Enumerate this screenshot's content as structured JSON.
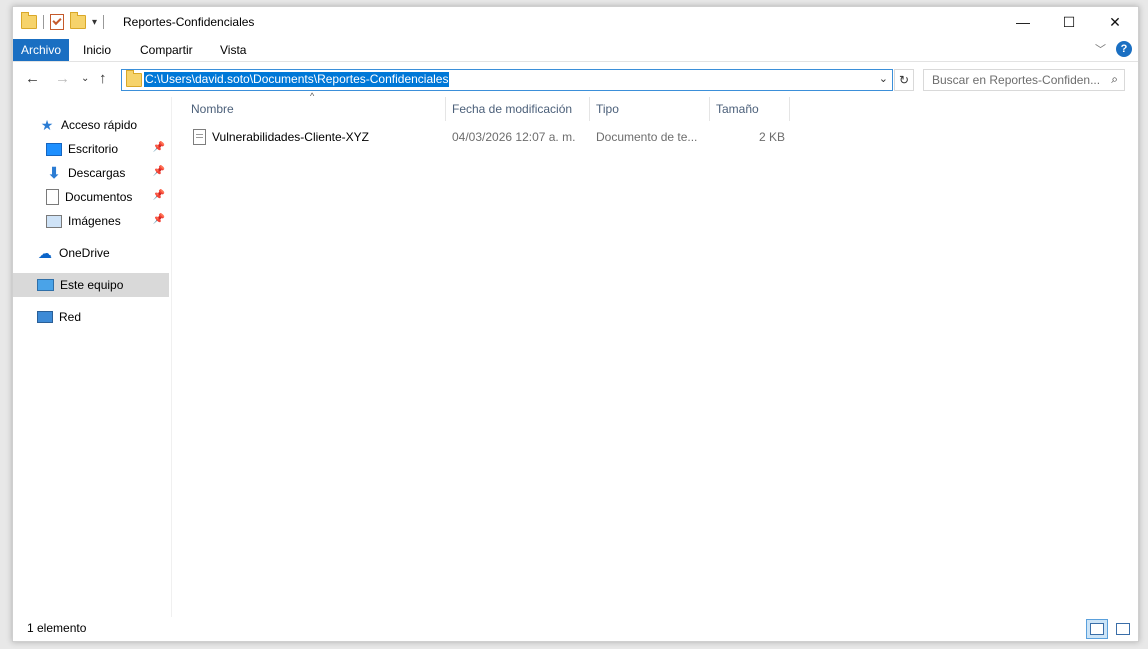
{
  "window": {
    "title": "Reportes-Confidenciales",
    "controls": {
      "minimize": "—",
      "maximize": "☐",
      "close": "✕"
    }
  },
  "ribbon": {
    "tabs": [
      "Archivo",
      "Inicio",
      "Compartir",
      "Vista"
    ],
    "help": "?"
  },
  "address": {
    "path": "C:\\Users\\david.soto\\Documents\\Reportes-Confidenciales"
  },
  "search": {
    "placeholder": "Buscar en Reportes-Confiden..."
  },
  "nav_pane": {
    "quick_access": "Acceso rápido",
    "pinned": [
      "Escritorio",
      "Descargas",
      "Documentos",
      "Imágenes"
    ],
    "onedrive": "OneDrive",
    "this_pc": "Este equipo",
    "network": "Red"
  },
  "columns": [
    "Nombre",
    "Fecha de modificación",
    "Tipo",
    "Tamaño"
  ],
  "files": [
    {
      "name": "Vulnerabilidades-Cliente-XYZ",
      "modified": "04/03/2026 12:07 a. m.",
      "type": "Documento de te...",
      "size": "2 KB"
    }
  ],
  "status_bar": {
    "count": "1 elemento"
  },
  "colors": {
    "accent": "#1a6fc2",
    "selection": "#0078d7",
    "nav_selected": "#d9d9d9"
  }
}
